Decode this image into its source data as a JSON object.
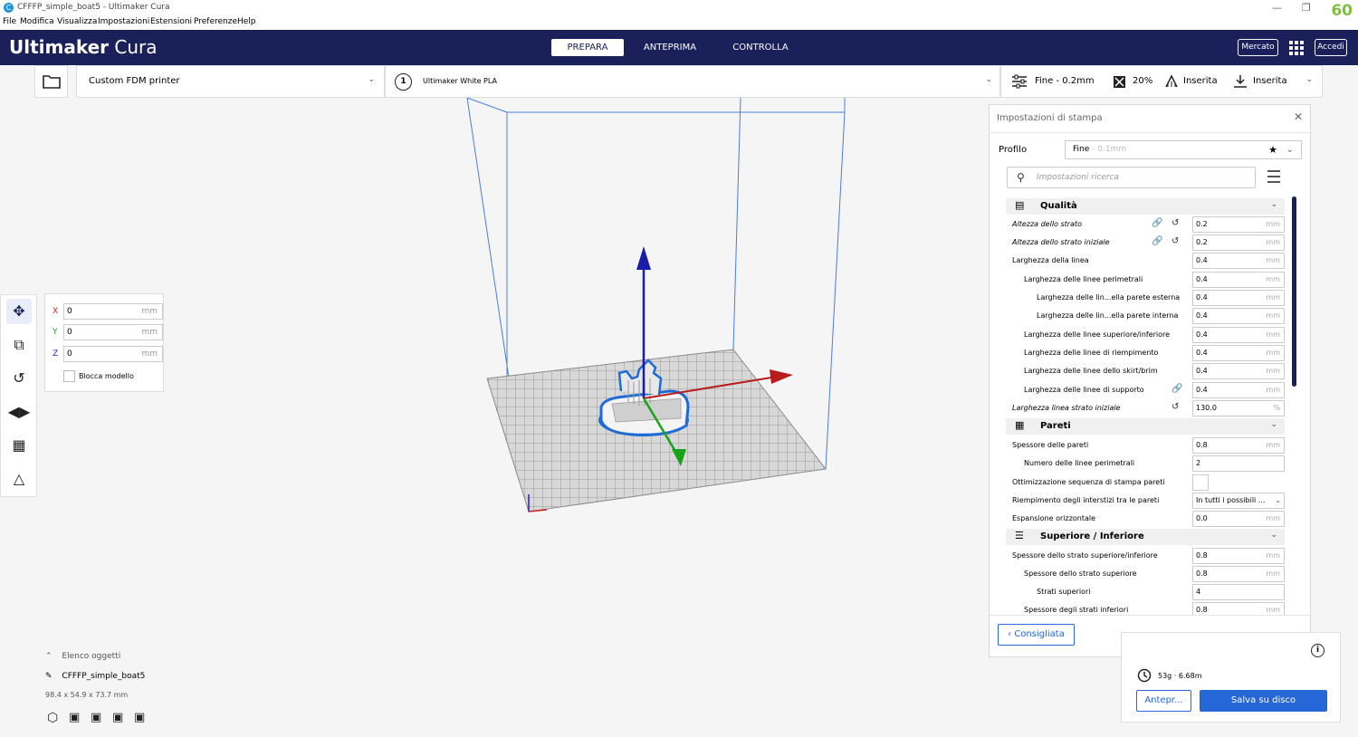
{
  "window": {
    "title": "CFFFP_simple_boat5 - Ultimaker Cura",
    "app_icon": "C",
    "minimize": "—",
    "maximize": "❐",
    "fps": "60"
  },
  "menu": [
    "File",
    "Modifica",
    "Visualizza",
    "Impostazioni",
    "Estensioni",
    "Preferenze",
    "Help"
  ],
  "header": {
    "logo_bold": "Ultimaker",
    "logo_light": "Cura",
    "tabs": [
      "PREPARA",
      "ANTEPRIMA",
      "CONTROLLA"
    ],
    "market": "Mercato",
    "login": "Accedi"
  },
  "toolbar": {
    "printer": "Custom FDM printer",
    "extruder_number": "1",
    "material": "Ultimaker White PLA",
    "quality": "Fine - 0.2mm",
    "infill": "20%",
    "support": "Inserita",
    "adhesion": "Inserita"
  },
  "move_panel": {
    "x_label": "X",
    "x_value": "0",
    "y_label": "Y",
    "y_value": "0",
    "z_label": "Z",
    "z_value": "0",
    "unit": "mm",
    "lock_label": "Blocca modello"
  },
  "settings": {
    "title": "Impostazioni di stampa",
    "profile_label": "Profilo",
    "profile_value": "Fine",
    "profile_dim": "- 0.1mm",
    "search_placeholder": "Impostazioni ricerca",
    "cat_quality": "Qualità",
    "cat_walls": "Pareti",
    "cat_topbottom": "Superiore / Inferiore",
    "rows": [
      {
        "label": "Altezza dello strato",
        "value": "0.2",
        "unit": "mm"
      },
      {
        "label": "Altezza dello strato iniziale",
        "value": "0.2",
        "unit": "mm"
      },
      {
        "label": "Larghezza della linea",
        "value": "0.4",
        "unit": "mm"
      },
      {
        "label": "Larghezza delle linee perimetrali",
        "value": "0.4",
        "unit": "mm"
      },
      {
        "label": "Larghezza delle lin...ella parete esterna",
        "value": "0.4",
        "unit": "mm"
      },
      {
        "label": "Larghezza delle lin...ella parete interna",
        "value": "0.4",
        "unit": "mm"
      },
      {
        "label": "Larghezza delle linee superiore/inferiore",
        "value": "0.4",
        "unit": "mm"
      },
      {
        "label": "Larghezza delle linee di riempimento",
        "value": "0.4",
        "unit": "mm"
      },
      {
        "label": "Larghezza delle linee dello skirt/brim",
        "value": "0.4",
        "unit": "mm"
      },
      {
        "label": "Larghezza delle linee di supporto",
        "value": "0.4",
        "unit": "mm"
      },
      {
        "label": "Larghezza linea strato iniziale",
        "value": "130.0",
        "unit": "%"
      },
      {
        "label": "Spessore delle pareti",
        "value": "0.8",
        "unit": "mm"
      },
      {
        "label": "Numero delle linee perimetrali",
        "value": "2",
        "unit": ""
      },
      {
        "label": "Ottimizzazione sequenza di stampa pareti",
        "value": "",
        "unit": ""
      },
      {
        "label": "Riempimento degli interstizi tra le pareti",
        "value": "In tutti i possibili ...",
        "unit": ""
      },
      {
        "label": "Espansione orizzontale",
        "value": "0.0",
        "unit": "mm"
      },
      {
        "label": "Spessore dello strato superiore/inferiore",
        "value": "0.8",
        "unit": "mm"
      },
      {
        "label": "Spessore dello strato superiore",
        "value": "0.8",
        "unit": "mm"
      },
      {
        "label": "Strati superiori",
        "value": "4",
        "unit": ""
      },
      {
        "label": "Spessore degli strati inferiori",
        "value": "0.8",
        "unit": "mm"
      }
    ],
    "recommended": "Consigliata"
  },
  "print": {
    "estimate": "53g · 6.68m",
    "preview": "Antepr...",
    "save": "Salva su disco"
  },
  "objects": {
    "header": "Elenco oggetti",
    "name": "CFFFP_simple_boat5",
    "dims": "98.4 x 54.9 x 73.7 mm"
  },
  "colors": {
    "header_bg": "#19205a",
    "accent_blue": "#2567d6",
    "save_button": "#2567d6"
  }
}
